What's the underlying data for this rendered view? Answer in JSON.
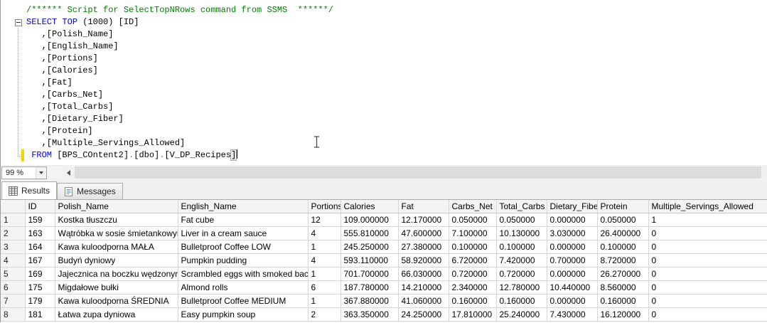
{
  "editor": {
    "zoom_value": "99 %",
    "lines": [
      {
        "segments": [
          {
            "text": "/****** Script for SelectTopNRows command from SSMS  ******/",
            "type": "comment"
          }
        ]
      },
      {
        "segments": [
          {
            "text": "SELECT",
            "type": "keyword"
          },
          {
            "text": " ",
            "type": "plain"
          },
          {
            "text": "TOP",
            "type": "keyword"
          },
          {
            "text": " (1000) [ID]",
            "type": "plain"
          }
        ]
      },
      {
        "segments": [
          {
            "text": "   ,[Polish_Name]",
            "type": "plain"
          }
        ]
      },
      {
        "segments": [
          {
            "text": "   ,[English_Name]",
            "type": "plain"
          }
        ]
      },
      {
        "segments": [
          {
            "text": "   ,[Portions]",
            "type": "plain"
          }
        ]
      },
      {
        "segments": [
          {
            "text": "   ,[Calories]",
            "type": "plain"
          }
        ]
      },
      {
        "segments": [
          {
            "text": "   ,[Fat]",
            "type": "plain"
          }
        ]
      },
      {
        "segments": [
          {
            "text": "   ,[Carbs_Net]",
            "type": "plain"
          }
        ]
      },
      {
        "segments": [
          {
            "text": "   ,[Total_Carbs]",
            "type": "plain"
          }
        ]
      },
      {
        "segments": [
          {
            "text": "   ,[Dietary_Fiber]",
            "type": "plain"
          }
        ]
      },
      {
        "segments": [
          {
            "text": "   ,[Protein]",
            "type": "plain"
          }
        ]
      },
      {
        "segments": [
          {
            "text": "   ,[Multiple_Servings_Allowed]",
            "type": "plain"
          }
        ]
      },
      {
        "caret": true,
        "segments": [
          {
            "text": " ",
            "type": "plain"
          },
          {
            "text": "FROM",
            "type": "keyword"
          },
          {
            "text": " [BPS_COntent2]",
            "type": "plain"
          },
          {
            "text": ".",
            "type": "operator"
          },
          {
            "text": "[dbo]",
            "type": "plain"
          },
          {
            "text": ".",
            "type": "operator"
          },
          {
            "text": "[V_DP_Recipes",
            "type": "plain"
          },
          {
            "text": "]",
            "type": "bracket"
          }
        ]
      }
    ]
  },
  "results": {
    "tabs": [
      {
        "label": "Results"
      },
      {
        "label": "Messages"
      }
    ],
    "grid": {
      "columns": [
        "ID",
        "Polish_Name",
        "English_Name",
        "Portions",
        "Calories",
        "Fat",
        "Carbs_Net",
        "Total_Carbs",
        "Dietary_Fiber",
        "Protein",
        "Multiple_Servings_Allowed"
      ],
      "rows": [
        {
          "n": "1",
          "cells": [
            "159",
            "Kostka tłuszczu",
            "Fat cube",
            "12",
            "109.000000",
            "12.170000",
            "0.050000",
            "0.050000",
            "0.000000",
            "0.050000",
            "1"
          ]
        },
        {
          "n": "2",
          "cells": [
            "163",
            "Wątróbka w sosie śmietankowym",
            "Liver in a cream sauce",
            "4",
            "555.810000",
            "47.600000",
            "7.100000",
            "10.130000",
            "3.030000",
            "26.400000",
            "0"
          ]
        },
        {
          "n": "3",
          "cells": [
            "164",
            "Kawa kuloodporna MAŁA",
            "Bulletproof Coffee LOW",
            "1",
            "245.250000",
            "27.380000",
            "0.100000",
            "0.100000",
            "0.000000",
            "0.100000",
            "0"
          ]
        },
        {
          "n": "4",
          "cells": [
            "167",
            "Budyń dyniowy",
            "Pumpkin pudding",
            "4",
            "593.110000",
            "58.920000",
            "6.720000",
            "7.420000",
            "0.700000",
            "8.720000",
            "0"
          ]
        },
        {
          "n": "5",
          "cells": [
            "169",
            "Jajecznica na boczku wędzonym",
            "Scrambled eggs with smoked bacon",
            "1",
            "701.700000",
            "66.030000",
            "0.720000",
            "0.720000",
            "0.000000",
            "26.270000",
            "0"
          ]
        },
        {
          "n": "6",
          "cells": [
            "175",
            "Migdałowe bułki",
            "Almond rolls",
            "6",
            "187.780000",
            "14.210000",
            "2.340000",
            "12.780000",
            "10.440000",
            "8.560000",
            "0"
          ]
        },
        {
          "n": "7",
          "cells": [
            "179",
            "Kawa kuloodporna ŚREDNIA",
            "Bulletproof Coffee MEDIUM",
            "1",
            "367.880000",
            "41.060000",
            "0.160000",
            "0.160000",
            "0.000000",
            "0.160000",
            "0"
          ]
        },
        {
          "n": "8",
          "cells": [
            "181",
            "Łatwa zupa dyniowa",
            "Easy pumpkin soup",
            "2",
            "363.350000",
            "24.250000",
            "17.810000",
            "25.240000",
            "7.430000",
            "16.120000",
            "0"
          ]
        }
      ]
    }
  },
  "colors": {
    "keyword": "#0000ff",
    "comment": "#008000",
    "change_bar": "#f0d500"
  }
}
